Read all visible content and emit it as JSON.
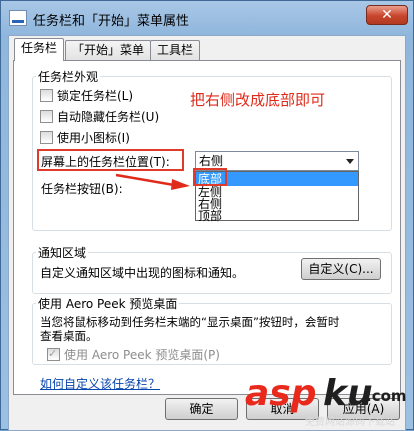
{
  "window": {
    "title": "任务栏和「开始」菜单属性",
    "close_glyph": "✕"
  },
  "tabs": [
    {
      "label": "任务栏"
    },
    {
      "label": "「开始」菜单"
    },
    {
      "label": "工具栏"
    }
  ],
  "appearance": {
    "legend": "任务栏外观",
    "options": [
      {
        "label": "锁定任务栏(L)",
        "checked": false
      },
      {
        "label": "自动隐藏任务栏(U)",
        "checked": false
      },
      {
        "label": "使用小图标(I)",
        "checked": false
      }
    ],
    "position_label": "屏幕上的任务栏位置(T):",
    "position_value": "右侧",
    "position_options": [
      "底部",
      "左侧",
      "右侧",
      "顶部"
    ],
    "buttons_label": "任务栏按钮(B):"
  },
  "annotation": "把右侧改成底部即可",
  "notification": {
    "legend": "通知区域",
    "text": "自定义通知区域中出现的图标和通知。",
    "customize_button": "自定义(C)..."
  },
  "aero": {
    "legend": "使用 Aero Peek 预览桌面",
    "text_line1": "当您将鼠标移动到任务栏末端的“显示桌面”按钮时，会暂时",
    "text_line2": "查看桌面。",
    "checkbox_label": "使用 Aero Peek 预览桌面(P)",
    "checkbox_checked": true
  },
  "help_link": "如何自定义该任务栏？",
  "footer": {
    "ok": "确定",
    "cancel": "取消",
    "apply": "应用(A)"
  },
  "watermark": {
    "brand": "asp",
    "brand_suffix": "ku",
    "domain": ".com",
    "tagline": "免费网站源码下载站"
  },
  "colors": {
    "annotation_red": "#e02a1a",
    "selection_blue": "#3399ff",
    "link_blue": "#0645ad"
  }
}
